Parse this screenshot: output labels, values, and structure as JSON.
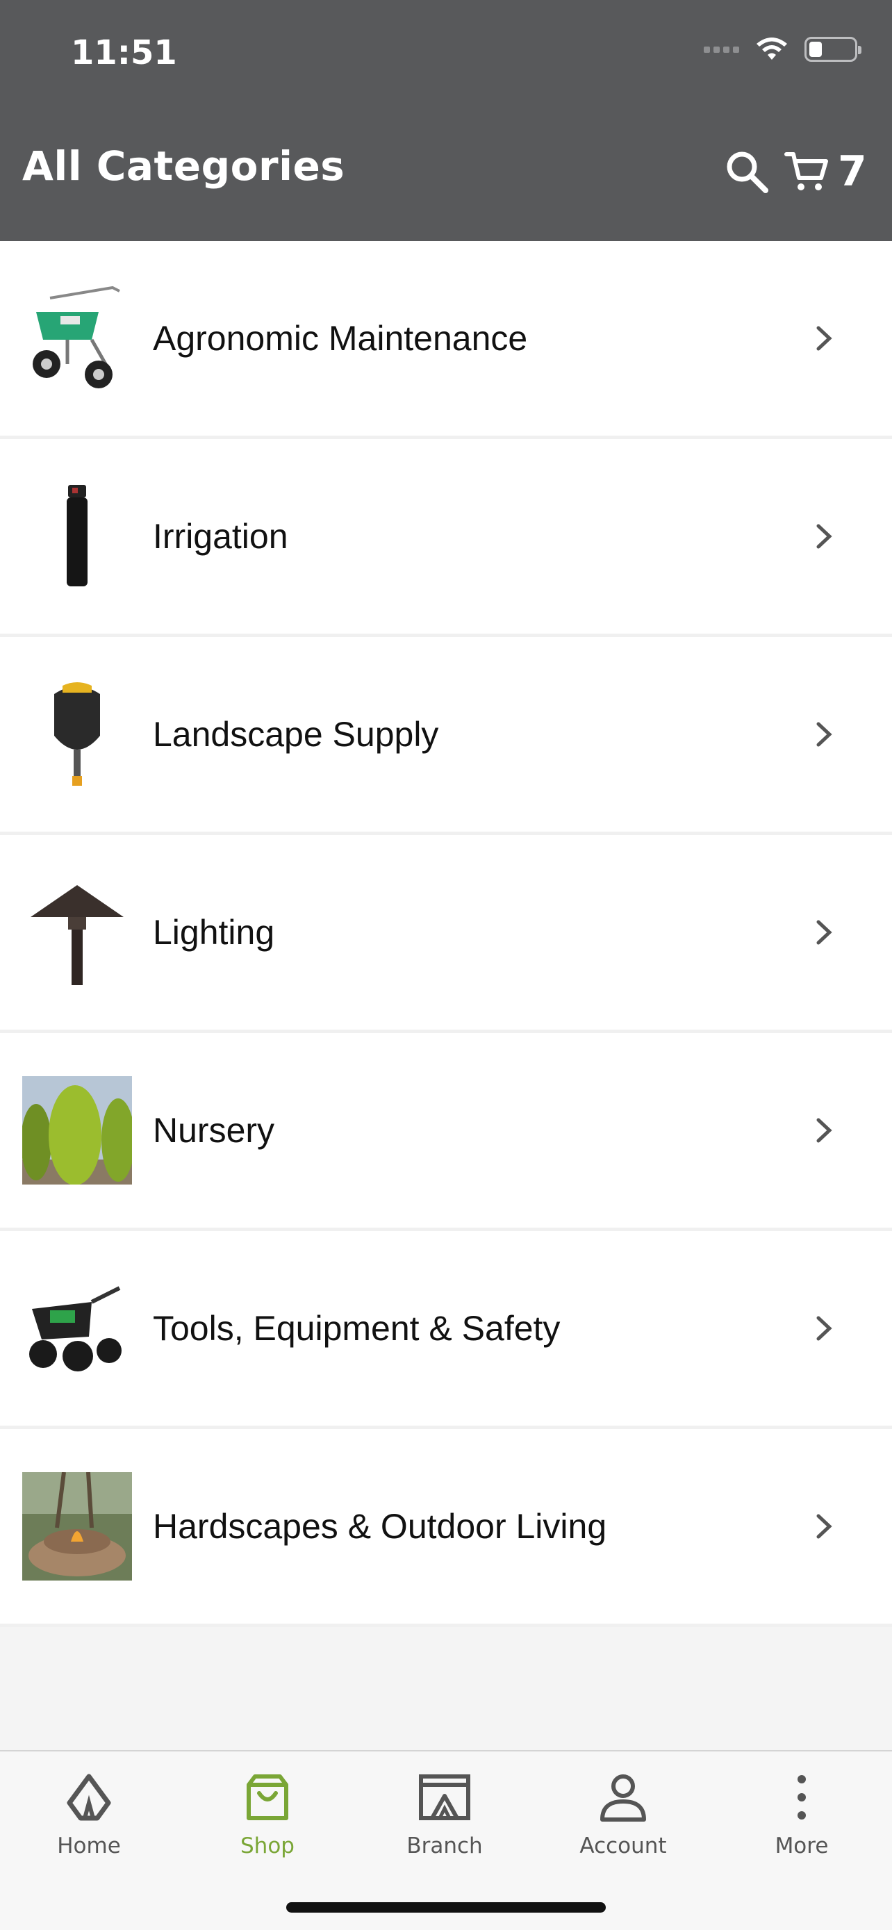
{
  "status_bar": {
    "time": "11:51"
  },
  "header": {
    "title": "All Categories",
    "cart_count": "7",
    "search_icon": "search-icon",
    "cart_icon": "cart-icon"
  },
  "categories": [
    {
      "label": "Agronomic Maintenance",
      "image": "spreader"
    },
    {
      "label": "Irrigation",
      "image": "sprinkler-head"
    },
    {
      "label": "Landscape Supply",
      "image": "shovel"
    },
    {
      "label": "Lighting",
      "image": "path-light"
    },
    {
      "label": "Nursery",
      "image": "shrubs"
    },
    {
      "label": "Tools, Equipment & Safety",
      "image": "power-wheelbarrow"
    },
    {
      "label": "Hardscapes & Outdoor Living",
      "image": "fire-pit"
    }
  ],
  "bottom_nav": [
    {
      "label": "Home",
      "icon": "home-icon",
      "active": false
    },
    {
      "label": "Shop",
      "icon": "shopping-bag-icon",
      "active": true
    },
    {
      "label": "Branch",
      "icon": "branch-store-icon",
      "active": false
    },
    {
      "label": "Account",
      "icon": "user-icon",
      "active": false
    },
    {
      "label": "More",
      "icon": "more-vertical-icon",
      "active": false
    }
  ],
  "colors": {
    "header_bg": "#58595b",
    "accent": "#7aa636",
    "list_bg": "#ffffff",
    "page_bg": "#f4f4f4"
  }
}
